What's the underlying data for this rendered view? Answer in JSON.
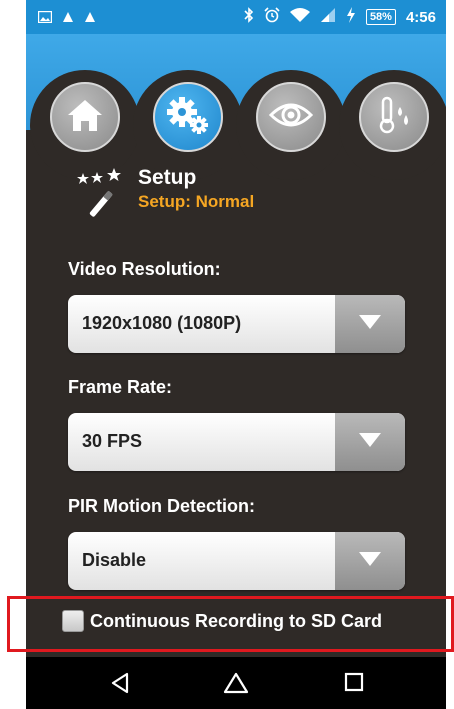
{
  "status_bar": {
    "battery": "58%",
    "time": "4:56",
    "icons": [
      "image-icon",
      "person-icon",
      "person-icon",
      "bluetooth-icon",
      "alarm-icon",
      "wifi-icon",
      "signal-icon",
      "charging-icon"
    ]
  },
  "tabs": [
    {
      "icon": "home-icon",
      "selected": false
    },
    {
      "icon": "gears-icon",
      "selected": true
    },
    {
      "icon": "eye-icon",
      "selected": false
    },
    {
      "icon": "thermometer-icon",
      "selected": false
    }
  ],
  "setup": {
    "title": "Setup",
    "subtitle": "Setup: Normal",
    "icon": "magic-wand-icon"
  },
  "fields": {
    "video_resolution": {
      "label": "Video Resolution:",
      "value": "1920x1080 (1080P)"
    },
    "frame_rate": {
      "label": "Frame Rate:",
      "value": "30 FPS"
    },
    "pir_motion": {
      "label": "PIR Motion Detection:",
      "value": "Disable"
    }
  },
  "continuous_recording": {
    "label": "Continuous Recording to SD Card",
    "checked": false
  },
  "navigation": [
    "back-icon",
    "home-icon",
    "recents-icon"
  ],
  "colors": {
    "accent_blue": "#2d94d6",
    "background": "#2f2a27",
    "subtitle_orange": "#f5a623",
    "highlight_red": "#e0191f"
  }
}
